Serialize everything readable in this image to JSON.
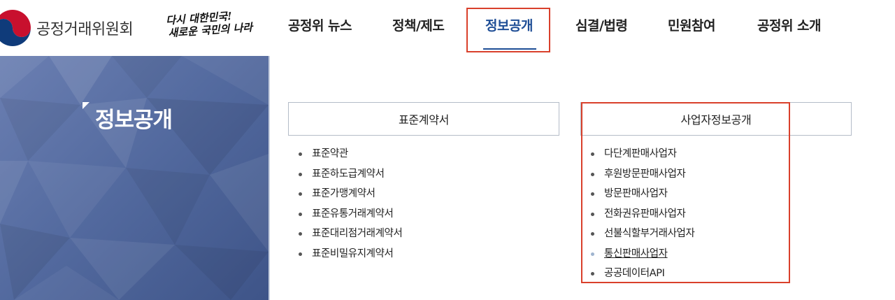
{
  "header": {
    "logo_text": "공정거래위원회",
    "slogan": [
      "다시 대한민국!",
      "새로운 국민의 나라"
    ]
  },
  "nav": {
    "items": [
      {
        "label": "공정위 뉴스"
      },
      {
        "label": "정책/제도"
      },
      {
        "label": "정보공개",
        "active": true
      },
      {
        "label": "심결/법령"
      },
      {
        "label": "민원참여"
      },
      {
        "label": "공정위 소개"
      }
    ]
  },
  "side": {
    "title": "정보공개"
  },
  "columns": [
    {
      "heading": "표준계약서",
      "items": [
        "표준약관",
        "표준하도급계약서",
        "표준가맹계약서",
        "표준유통거래계약서",
        "표준대리점거래계약서",
        "표준비밀유지계약서"
      ]
    },
    {
      "heading": "사업자정보공개",
      "items": [
        "다단계판매사업자",
        "후원방문판매사업자",
        "방문판매사업자",
        "전화권유판매사업자",
        "선불식할부거래사업자",
        "통신판매사업자",
        "공공데이터API"
      ],
      "selected_item": "통신판매사업자"
    }
  ],
  "colors": {
    "brand_blue": "#1f4e96",
    "highlight_red": "#d9402b",
    "panel_blue": "#52699e"
  }
}
